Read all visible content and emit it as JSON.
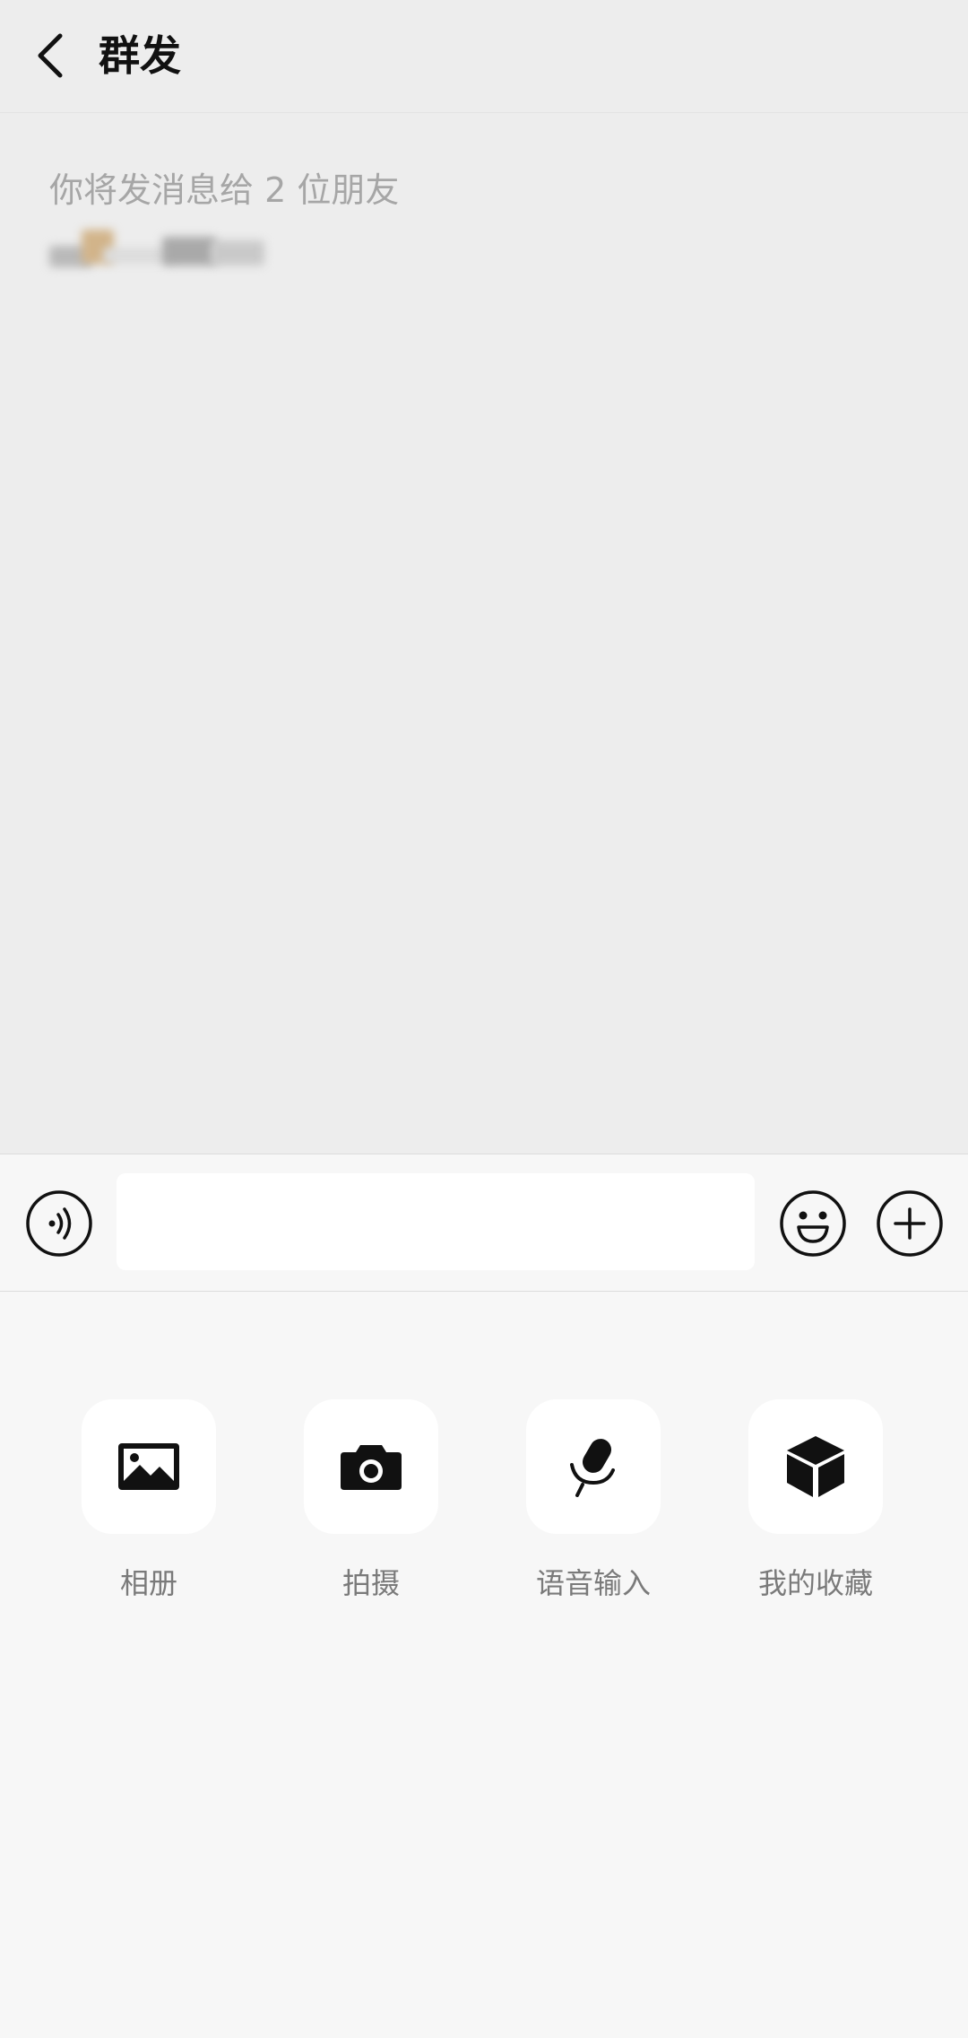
{
  "header": {
    "back_icon": "chevron-left-icon",
    "title": "群发"
  },
  "body": {
    "recipients_note": "你将发消息给 2 位朋友"
  },
  "input_bar": {
    "voice_icon": "voice-wave-icon",
    "input_value": "",
    "emoji_icon": "smiley-icon",
    "plus_icon": "plus-circle-icon"
  },
  "panel": {
    "items": [
      {
        "label": "相册",
        "icon": "album-image-icon"
      },
      {
        "label": "拍摄",
        "icon": "camera-icon"
      },
      {
        "label": "语音输入",
        "icon": "microphone-icon"
      },
      {
        "label": "我的收藏",
        "icon": "cube-favorites-icon"
      }
    ]
  },
  "colors": {
    "background": "#ededed",
    "panel_background": "#f7f7f7",
    "tile_background": "#ffffff",
    "title_text": "#111111",
    "muted_text": "#a6a6a6",
    "label_text": "#7a7a7a"
  }
}
